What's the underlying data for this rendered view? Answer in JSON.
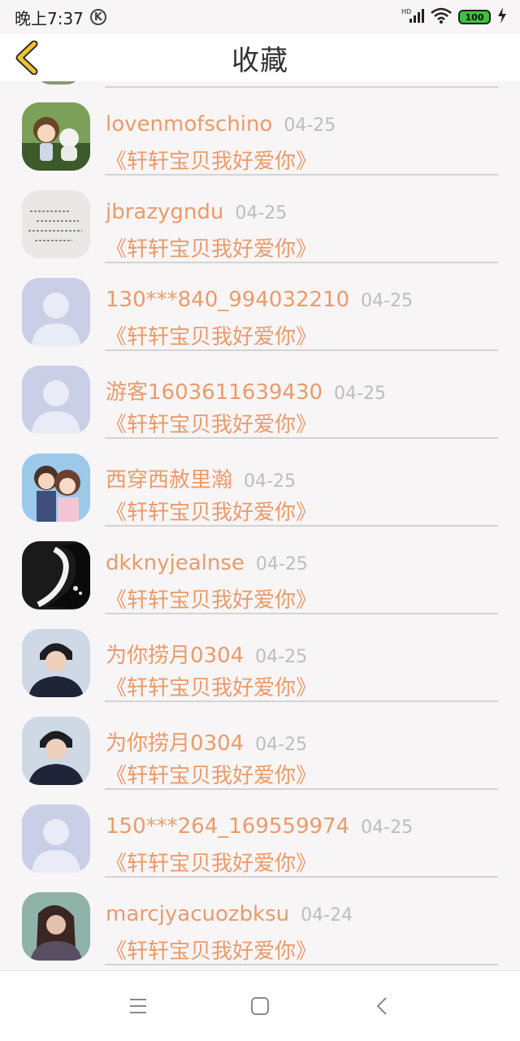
{
  "status": {
    "time": "晚上7:37",
    "k_badge": "K",
    "network": "HD",
    "battery": "100"
  },
  "header": {
    "title": "收藏",
    "back_icon": "chevron-left-icon"
  },
  "colors": {
    "accent": "#eb9b6a",
    "date": "#bdbdbd",
    "divider": "#d3d3d3"
  },
  "favorites": [
    {
      "name": "lovenmofschino",
      "date": "04-25",
      "post": "《轩轩宝贝我好爱你》",
      "avatar": "anime-figure-avatar"
    },
    {
      "name": "jbrazygndu",
      "date": "04-25",
      "post": "《轩轩宝贝我好爱你》",
      "avatar": "handwriting-avatar"
    },
    {
      "name": "130***840_994032210",
      "date": "04-25",
      "post": "《轩轩宝贝我好爱你》",
      "avatar": "default-avatar"
    },
    {
      "name": "游客1603611639430",
      "date": "04-25",
      "post": "《轩轩宝贝我好爱你》",
      "avatar": "default-avatar"
    },
    {
      "name": "西穿西赦里瀚",
      "date": "04-25",
      "post": "《轩轩宝贝我好爱你》",
      "avatar": "anime-couple-avatar"
    },
    {
      "name": "dkknyjealnse",
      "date": "04-25",
      "post": "《轩轩宝贝我好爱你》",
      "avatar": "ink-art-avatar"
    },
    {
      "name": "为你捞月0304",
      "date": "04-25",
      "post": "《轩轩宝贝我好爱你》",
      "avatar": "boy-photo-avatar"
    },
    {
      "name": "为你捞月0304",
      "date": "04-25",
      "post": "《轩轩宝贝我好爱你》",
      "avatar": "boy-photo-avatar"
    },
    {
      "name": "150***264_169559974",
      "date": "04-25",
      "post": "《轩轩宝贝我好爱你》",
      "avatar": "default-avatar"
    },
    {
      "name": "marcjyacuozbksu",
      "date": "04-24",
      "post": "《轩轩宝贝我好爱你》",
      "avatar": "girl-photo-avatar"
    }
  ],
  "nav": {
    "menu_icon": "menu-icon",
    "home_icon": "home-square-icon",
    "back_icon": "back-triangle-icon"
  }
}
